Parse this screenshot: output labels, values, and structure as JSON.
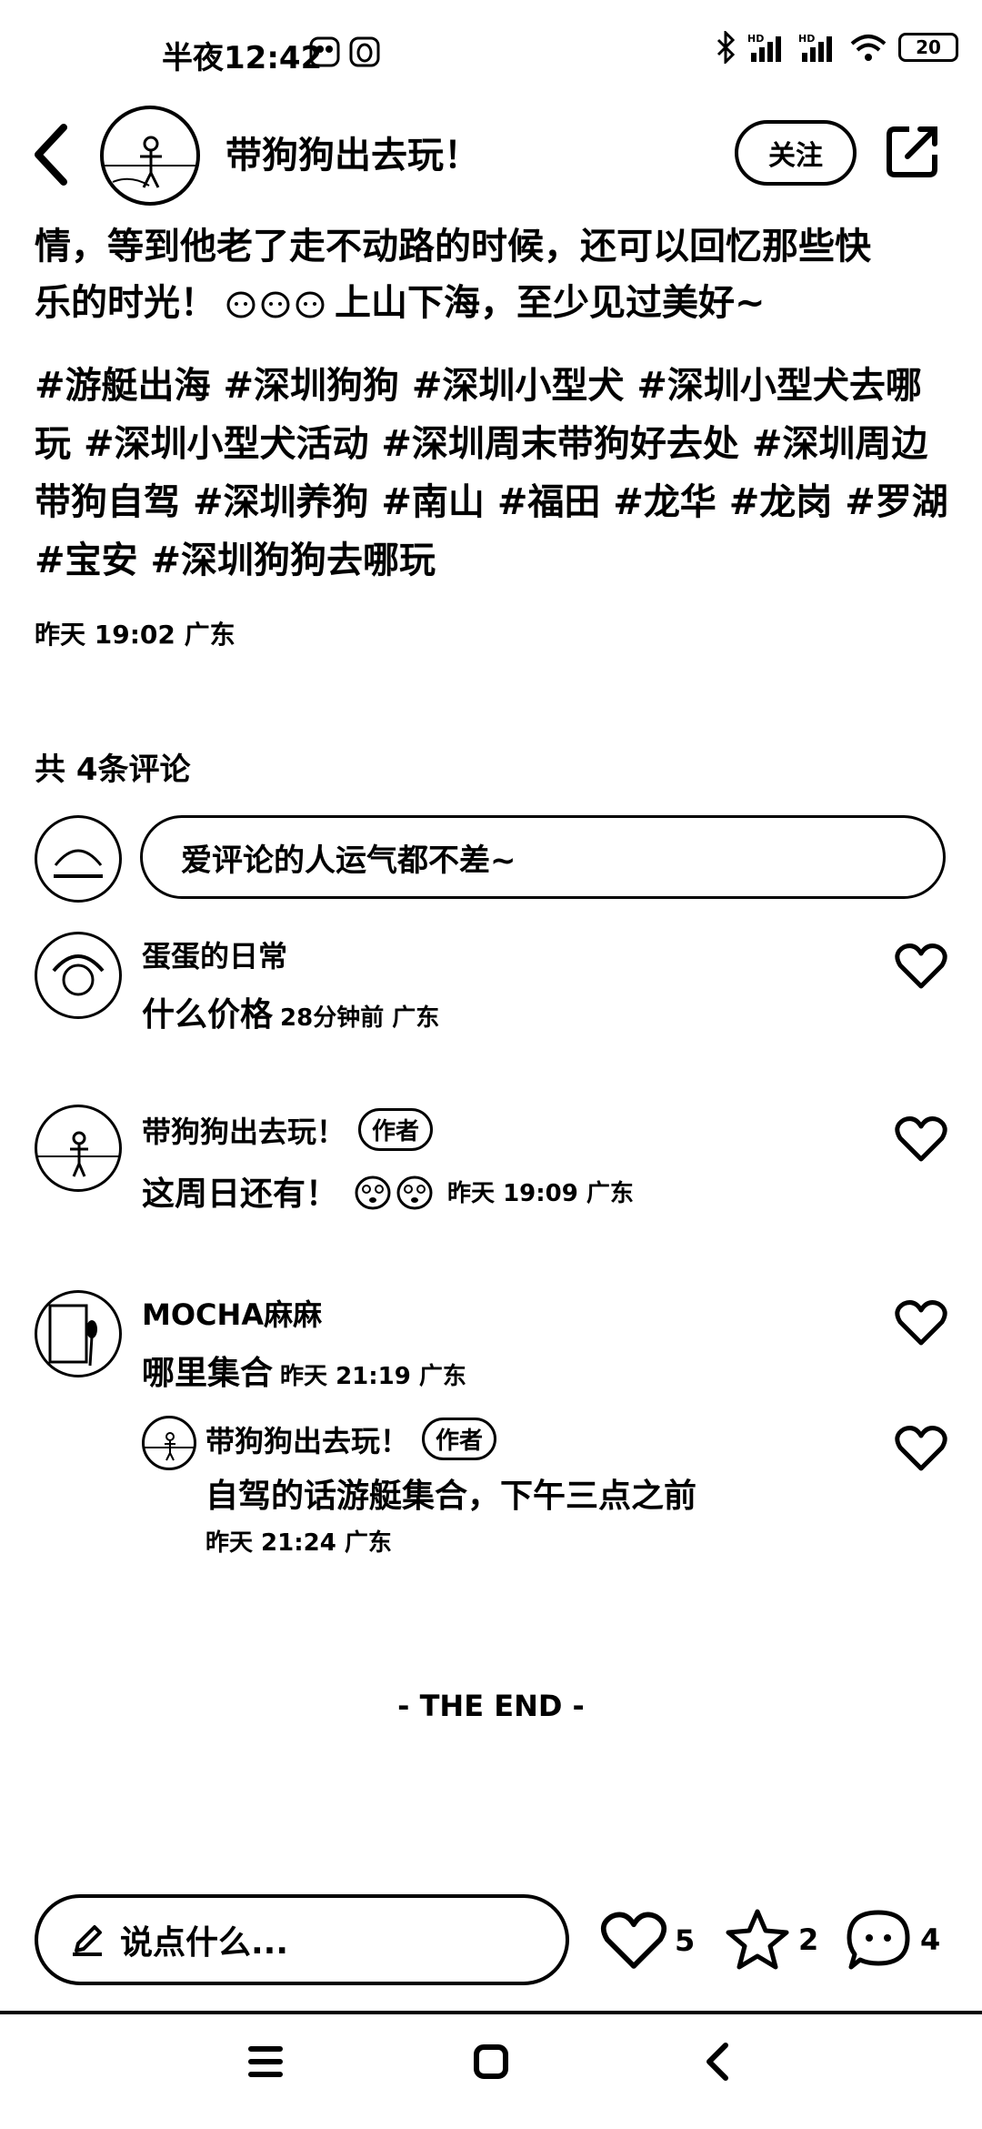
{
  "status_bar": {
    "time": "半夜12:42",
    "battery": "20"
  },
  "header": {
    "author": "带狗狗出去玩！",
    "follow_label": "关注"
  },
  "post": {
    "text_line1": "情，等到他老了走不动路的时候，还可以回忆那些快",
    "text_line2_start": "乐的时光！",
    "text_line2_end": "上山下海，至少见过美好~",
    "tags": [
      "#游艇出海",
      "#深圳狗狗",
      "#深圳小型犬",
      "#深圳小型犬去哪玩",
      "#深圳小型犬活动",
      "#深圳周末带狗好去处",
      "#深圳周边带狗自驾",
      "#深圳养狗",
      "#南山",
      "#福田",
      "#龙华",
      "#龙岗",
      "#罗湖",
      "#宝安",
      "#深圳狗狗去哪玩"
    ],
    "date": "昨天 19:02 广东"
  },
  "comments_section": {
    "count_label": "共 4条评论",
    "input_placeholder": "爱评论的人运气都不差~",
    "comments": [
      {
        "user": "蛋蛋的日常",
        "text": "什么价格",
        "meta": "28分钟前 广东"
      },
      {
        "user": "带狗狗出去玩！",
        "badge": "作者",
        "text": "这周日还有！",
        "meta": "昨天 19:09 广东"
      },
      {
        "user": "MOCHA麻麻",
        "text": "哪里集合",
        "meta": "昨天 21:19 广东",
        "reply": {
          "user": "带狗狗出去玩！",
          "badge": "作者",
          "text": "自驾的话游艇集合，下午三点之前",
          "meta": "昨天 21:24 广东"
        }
      }
    ],
    "end_label": "- THE END -"
  },
  "bottom_bar": {
    "say_placeholder": "说点什么...",
    "likes": "5",
    "favorites": "2",
    "comments": "4"
  }
}
